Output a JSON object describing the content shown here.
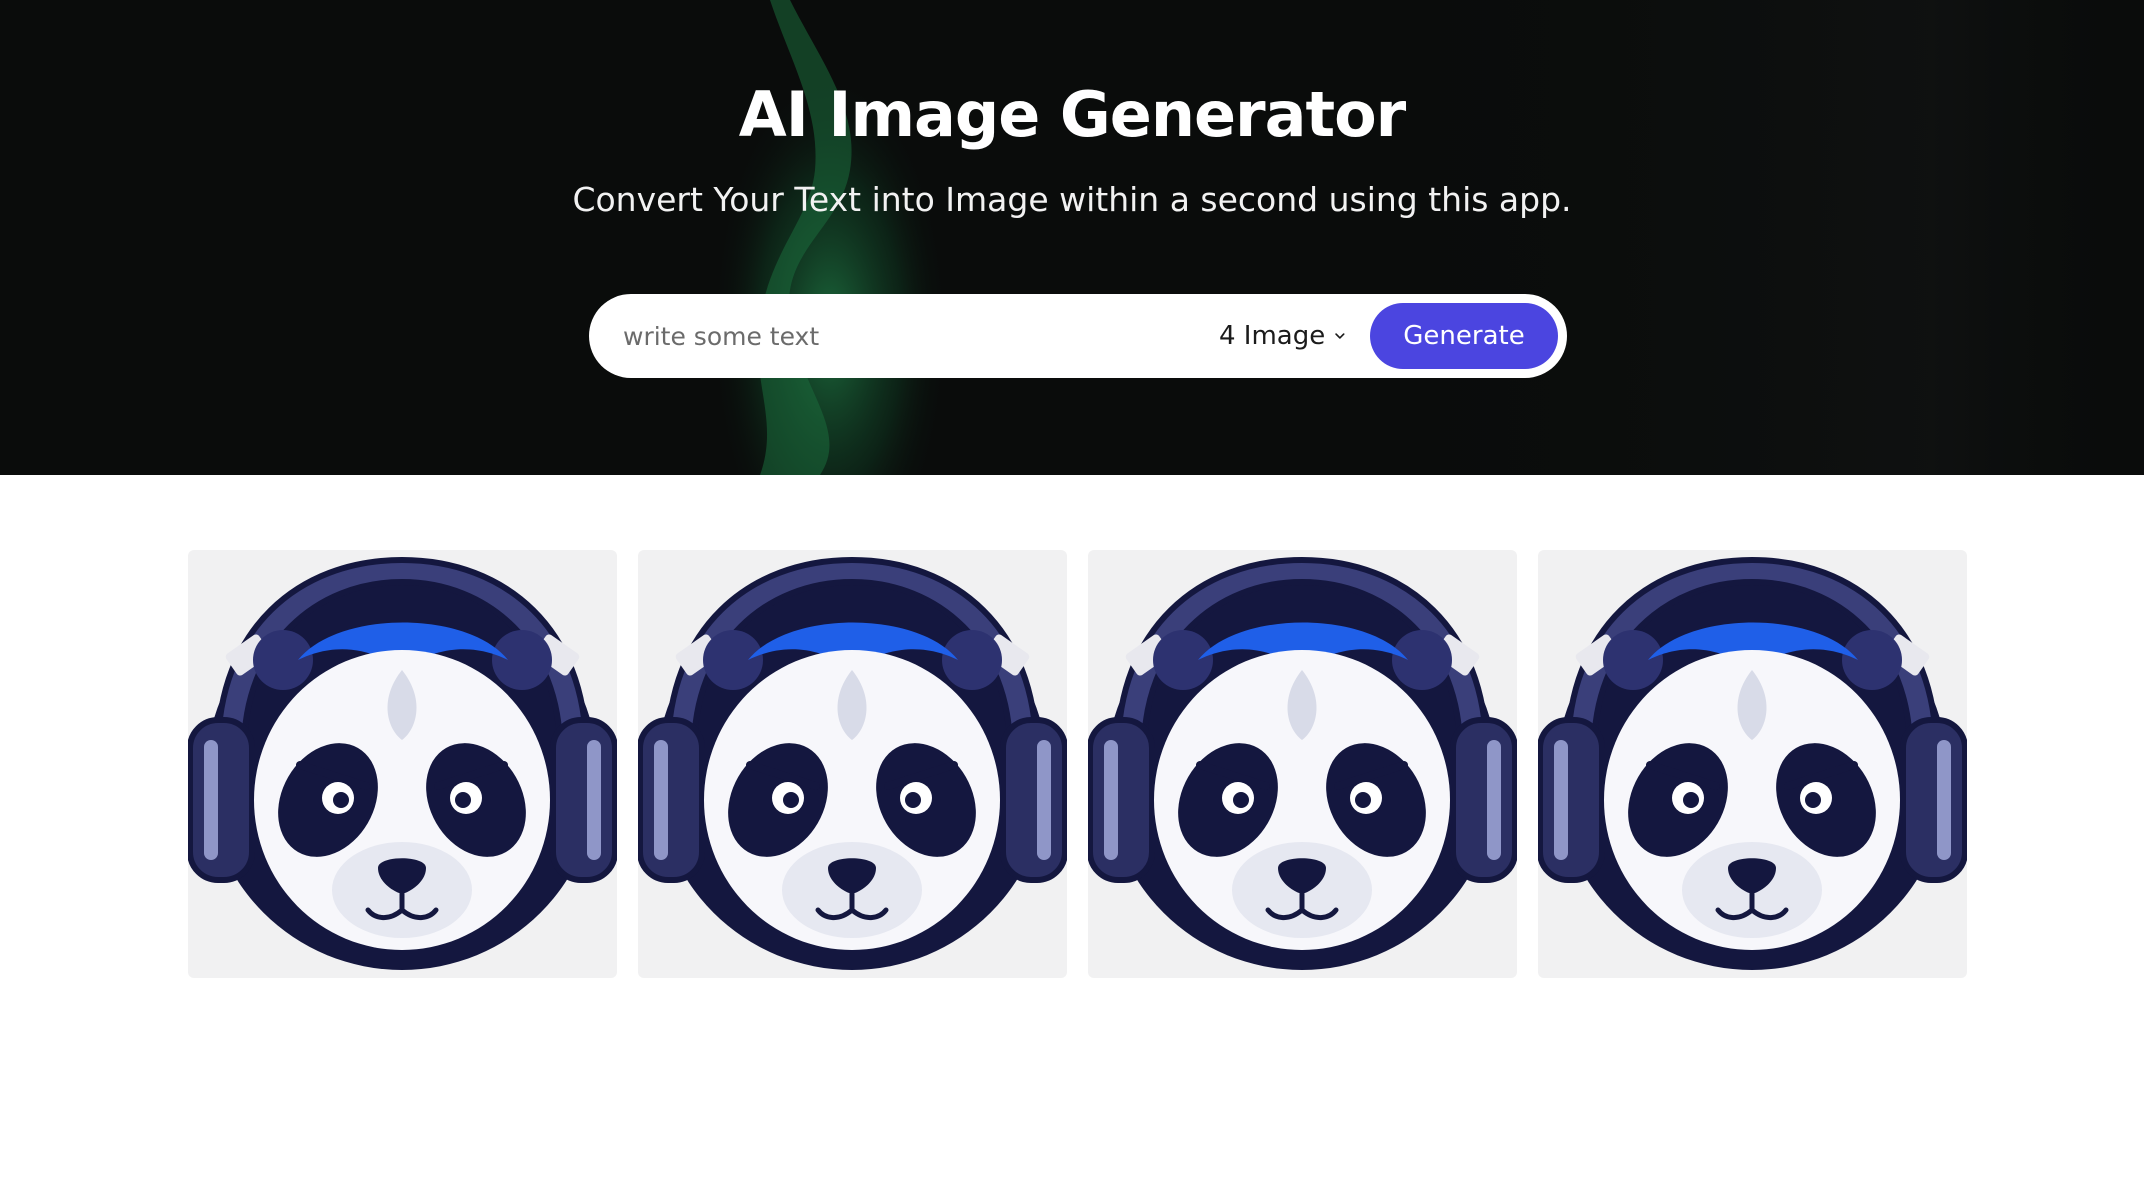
{
  "hero": {
    "title": "AI Image Generator",
    "subtitle": "Convert Your Text into Image within a second using this app."
  },
  "search": {
    "placeholder": "write some text",
    "value": "",
    "count_selected": "4 Image",
    "generate_label": "Generate"
  },
  "gallery": {
    "items": [
      {
        "icon": "panda-headphones-image"
      },
      {
        "icon": "panda-headphones-image"
      },
      {
        "icon": "panda-headphones-image"
      },
      {
        "icon": "panda-headphones-image"
      }
    ]
  },
  "colors": {
    "accent": "#4b45e0",
    "hero_bg": "#0a0c0b",
    "card_bg": "#f1f1f2",
    "panda_blue": "#1f5fe8",
    "panda_navy": "#14173f"
  }
}
